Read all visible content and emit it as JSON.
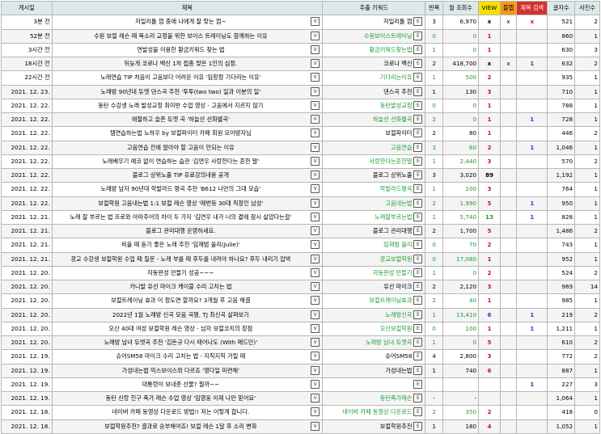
{
  "headers": {
    "date": "게시일",
    "title": "제목",
    "keyword": "추출 키워드",
    "count": "반복",
    "views": "월 조회수",
    "view_flag": "VIEW",
    "blog_flag": "블랩",
    "title_search": "제목 검색",
    "chars": "글자수",
    "photos": "사진수"
  },
  "button_labels": {
    "view": "V",
    "extract": "E"
  },
  "rows": [
    {
      "date": "3분 전",
      "title": "자일리톨 껌 중에 나에게 잘 맞는 껌~",
      "keyword": "자일리톨 껌",
      "kw_green": false,
      "count": "3",
      "count_green": false,
      "views": "6,970",
      "views_green": false,
      "view_flag": "x",
      "view_color": "black",
      "blog": "x",
      "search": "x",
      "search_color": "red",
      "chars": "521",
      "photos": "2"
    },
    {
      "date": "52분 전",
      "title": "수원 보컬 레슨 때 목소리 교정을 위한 보이스 트레이닝도 함께하는 이유",
      "keyword": "수원보이스트레이닝",
      "kw_green": true,
      "count": "0",
      "count_green": true,
      "views": "0",
      "views_green": true,
      "view_flag": "1",
      "view_color": "red",
      "blog": "",
      "search": "",
      "search_color": "",
      "chars": "860",
      "photos": "1"
    },
    {
      "date": "3시간 전",
      "title": "연발성을 이용한 황금키워드 찾는 법",
      "keyword": "황금키워드찾는법",
      "kw_green": true,
      "count": "1",
      "count_green": true,
      "views": "0",
      "views_green": true,
      "view_flag": "1",
      "view_color": "red",
      "blog": "",
      "search": "",
      "search_color": "",
      "chars": "630",
      "photos": "3"
    },
    {
      "date": "18시간 전",
      "title": "뒤늦게 코로나 백신 1차 접종 맞은 1인의 심정.",
      "keyword": "코로나 백신",
      "kw_green": false,
      "count": "2",
      "count_green": false,
      "views": "418,700",
      "views_green": false,
      "view_flag": "x",
      "view_color": "black",
      "blog": "x",
      "search": "1",
      "search_color": "blue",
      "chars": "632",
      "photos": "2"
    },
    {
      "date": "22시간 전",
      "title": "노래연습 TIP 처음이 고음보다 어려운 이유 '임창정 기다리는 이유'",
      "keyword": "기다리는이유",
      "kw_green": true,
      "count": "1",
      "count_green": true,
      "views": "500",
      "views_green": true,
      "view_flag": "2",
      "view_color": "red",
      "blog": "",
      "search": "",
      "search_color": "",
      "chars": "935",
      "photos": "1"
    },
    {
      "date": "2021. 12. 23.",
      "title": "노래방 90년대 듀엣 댄스곡 추천 '투투(two two) 일과 이분의 일'",
      "keyword": "댄스곡 추천",
      "kw_green": false,
      "count": "1",
      "count_green": false,
      "views": "130",
      "views_green": false,
      "view_flag": "3",
      "view_color": "red",
      "blog": "",
      "search": "",
      "search_color": "",
      "chars": "710",
      "photos": "1"
    },
    {
      "date": "2021. 12. 22.",
      "title": "동탄 수강생 노래 발성교정 취미반 수업 영상 - 고음에서 지르지 않기",
      "keyword": "동탄발성교정",
      "kw_green": true,
      "count": "0",
      "count_green": true,
      "views": "0",
      "views_green": true,
      "view_flag": "1",
      "view_color": "red",
      "blog": "",
      "search": "",
      "search_color": "",
      "chars": "788",
      "photos": "1"
    },
    {
      "date": "2021. 12. 22.",
      "title": "애절하고 슬픈 듀엣 곡 '하늘선 선화별곡'",
      "keyword": "하늘선 선화별곡",
      "kw_green": true,
      "count": "2",
      "count_green": true,
      "views": "0",
      "views_green": true,
      "view_flag": "1",
      "view_color": "red",
      "blog": "",
      "search": "1",
      "search_color": "blue",
      "chars": "728",
      "photos": "1"
    },
    {
      "date": "2021. 12. 22.",
      "title": "탬연습하는법 노하우 by 보컬파이터 카페 회원 모아방자님",
      "keyword": "보컬파이터",
      "kw_green": false,
      "count": "2",
      "count_green": false,
      "views": "80",
      "views_green": false,
      "view_flag": "1",
      "view_color": "red",
      "blog": "",
      "search": "",
      "search_color": "",
      "chars": "446",
      "photos": "2"
    },
    {
      "date": "2021. 12. 22.",
      "title": "고음연습 전에 알아야 할 고음이 안되는 이유",
      "keyword": "고음연습",
      "kw_green": true,
      "count": "3",
      "count_green": true,
      "views": "60",
      "views_green": true,
      "view_flag": "2",
      "view_color": "red",
      "blog": "",
      "search": "1",
      "search_color": "blue",
      "chars": "1,046",
      "photos": "1"
    },
    {
      "date": "2021. 12. 22.",
      "title": "노래배우기 예코 없이 연습하는 습관 '김연우 사랑한다는 흔한 말'",
      "keyword": "사랑한다는흔한말",
      "kw_green": true,
      "count": "1",
      "count_green": true,
      "views": "2,440",
      "views_green": true,
      "view_flag": "3",
      "view_color": "red",
      "blog": "",
      "search": "",
      "search_color": "",
      "chars": "570",
      "photos": "2"
    },
    {
      "date": "2021. 12. 22.",
      "title": "블로그 상위노출 TIP 유료강의내용 공개",
      "keyword": "블로그 상위노출",
      "kw_green": false,
      "count": "3",
      "count_green": false,
      "views": "3,020",
      "views_green": false,
      "view_flag": "89",
      "view_color": "black",
      "blog": "",
      "search": "",
      "search_color": "",
      "chars": "1,192",
      "photos": "1"
    },
    {
      "date": "2021. 12. 22.",
      "title": "노래방 남자 90년대 락발라드 명곡 추천 'B612 나만의 그대 모습'",
      "keyword": "락발라드명곡",
      "kw_green": true,
      "count": "1",
      "count_green": true,
      "views": "100",
      "views_green": true,
      "view_flag": "3",
      "view_color": "red",
      "blog": "",
      "search": "",
      "search_color": "",
      "chars": "764",
      "photos": "1"
    },
    {
      "date": "2021. 12. 22.",
      "title": "보컬학원 고음내는법 1:1 보컬 레슨 영상 '매번등 30대 직장인 남성'",
      "keyword": "고음내는법",
      "kw_green": true,
      "count": "2",
      "count_green": true,
      "views": "1,990",
      "views_green": true,
      "view_flag": "5",
      "view_color": "red",
      "blog": "",
      "search": "1",
      "search_color": "blue",
      "chars": "950",
      "photos": "1"
    },
    {
      "date": "2021. 12. 21.",
      "title": "노래 잘 부르는 법 프로와 아마추어의 차이 두 가지 '김연우 내가 너의 곁에 잠시 살았다는걸'",
      "keyword": "노래잘부르는법",
      "kw_green": true,
      "count": "1",
      "count_green": true,
      "views": "5,740",
      "views_green": true,
      "view_flag": "13",
      "view_color": "green",
      "blog": "",
      "search": "1",
      "search_color": "blue",
      "chars": "828",
      "photos": "1"
    },
    {
      "date": "2021. 12. 21.",
      "title": "블로그 관리대행 운영하세요.",
      "keyword": "블로그 관리대행",
      "kw_green": false,
      "count": "2",
      "count_green": false,
      "views": "1,700",
      "views_green": false,
      "view_flag": "5",
      "view_color": "red",
      "blog": "",
      "search": "",
      "search_color": "",
      "chars": "1,486",
      "photos": "2"
    },
    {
      "date": "2021. 12. 21.",
      "title": "비올 때 듣기 좋은 노래 추천 '임재범 올리(Julie)'",
      "keyword": "임재범 올리",
      "kw_green": true,
      "count": "0",
      "count_green": true,
      "views": "70",
      "views_green": true,
      "view_flag": "2",
      "view_color": "red",
      "blog": "",
      "search": "",
      "search_color": "",
      "chars": "743",
      "photos": "1"
    },
    {
      "date": "2021. 12. 21.",
      "title": "광교 수강생 보컬학원 수업 때 질문 - 노래 부를 때 후두를 내려야 하나요? 후두 내리기 압박",
      "keyword": "광교보컬학원",
      "kw_green": true,
      "count": "0",
      "count_green": true,
      "views": "17,080",
      "views_green": true,
      "view_flag": "1",
      "view_color": "red",
      "blog": "",
      "search": "",
      "search_color": "",
      "chars": "952",
      "photos": "1"
    },
    {
      "date": "2021. 12. 20.",
      "title": "자동완성 만들기 성공~~~",
      "keyword": "자동완성 만들기",
      "kw_green": true,
      "count": "1",
      "count_green": true,
      "views": "0",
      "views_green": true,
      "view_flag": "2",
      "view_color": "red",
      "blog": "",
      "search": "",
      "search_color": "",
      "chars": "524",
      "photos": "2"
    },
    {
      "date": "2021. 12. 20.",
      "title": "카니발 유선 마이크 케이블 수리 고치는 법",
      "keyword": "유선 마이크",
      "kw_green": false,
      "count": "2",
      "count_green": false,
      "views": "2,120",
      "views_green": false,
      "view_flag": "3",
      "view_color": "red",
      "blog": "",
      "search": "",
      "search_color": "",
      "chars": "969",
      "photos": "14"
    },
    {
      "date": "2021. 12. 20.",
      "title": "보컬트레이닝 효과 이 정도면 할까요? 3개월 후 고음 해결",
      "keyword": "보컬트레이닝효과",
      "kw_green": true,
      "count": "2",
      "count_green": true,
      "views": "40",
      "views_green": true,
      "view_flag": "1",
      "view_color": "red",
      "blog": "",
      "search": "",
      "search_color": "",
      "chars": "985",
      "photos": "1"
    },
    {
      "date": "2021. 12. 20.",
      "title": "2022년 1월 노래방 신곡 모음 곡명, TJ 최신곡 살펴보기",
      "keyword": "노래방신곡",
      "kw_green": true,
      "count": "1",
      "count_green": true,
      "views": "13,410",
      "views_green": true,
      "view_flag": "6",
      "view_color": "blue",
      "blog": "",
      "search": "1",
      "search_color": "blue",
      "chars": "219",
      "photos": "2"
    },
    {
      "date": "2021. 12. 20.",
      "title": "오산 40대 여성 보컬학원 레슨 영상 - 남자 보컬코치의 장점",
      "keyword": "오산보컬학원",
      "kw_green": true,
      "count": "0",
      "count_green": true,
      "views": "100",
      "views_green": true,
      "view_flag": "1",
      "view_color": "red",
      "blog": "",
      "search": "1",
      "search_color": "blue",
      "chars": "1,211",
      "photos": "1"
    },
    {
      "date": "2021. 12. 20.",
      "title": "노래방 남녀 듀엣곡 추천 '김돈규 다시 태어나도 (With 메드민)'",
      "keyword": "노래방 남녀 듀엣곡",
      "kw_green": true,
      "count": "1",
      "count_green": true,
      "views": "0",
      "views_green": true,
      "view_flag": "5",
      "view_color": "red",
      "blog": "",
      "search": "",
      "search_color": "",
      "chars": "610",
      "photos": "2"
    },
    {
      "date": "2021. 12. 19.",
      "title": "슈어SM58 마이크 수리 고치는 법 - 지직지직 거릴 때",
      "keyword": "슈어SM58",
      "kw_green": false,
      "count": "4",
      "count_green": false,
      "views": "2,800",
      "views_green": false,
      "view_flag": "3",
      "view_color": "red",
      "blog": "",
      "search": "",
      "search_color": "",
      "chars": "772",
      "photos": "2"
    },
    {
      "date": "2021. 12. 19.",
      "title": "가성내는법 믹스보이스와 다르죠 '영다일 미련해'",
      "keyword": "가성내는법",
      "kw_green": false,
      "count": "1",
      "count_green": false,
      "views": "740",
      "views_green": false,
      "view_flag": "6",
      "view_color": "red",
      "blog": "",
      "search": "",
      "search_color": "",
      "chars": "887",
      "photos": "1"
    },
    {
      "date": "2021. 12. 19.",
      "title": "대통령이 보내준 선물? 뭘까~~",
      "keyword": "",
      "kw_green": false,
      "count": "",
      "count_green": false,
      "views": "",
      "views_green": false,
      "view_flag": "",
      "view_color": "",
      "blog": "",
      "search": "1",
      "search_color": "blue",
      "chars": "227",
      "photos": "3"
    },
    {
      "date": "2021. 12. 19.",
      "title": "동탄 신랑 친구 축가 레슨 수업 영상 '임영웅 이제 나만 믿어요'",
      "keyword": "동탄축가레슨",
      "kw_green": true,
      "count": "-",
      "count_green": false,
      "views": "-",
      "views_green": false,
      "view_flag": "",
      "view_color": "",
      "blog": "",
      "search": "",
      "search_color": "",
      "chars": "1,064",
      "photos": "1"
    },
    {
      "date": "2021. 12. 18.",
      "title": "네이버 카페 동영상 다운로드 방법!! 저는 이렇게 합니다.",
      "keyword": "네이버 카페 동영상 다운로드",
      "kw_green": true,
      "count": "2",
      "count_green": true,
      "views": "350",
      "views_green": true,
      "view_flag": "2",
      "view_color": "red",
      "blog": "",
      "search": "",
      "search_color": "",
      "chars": "418",
      "photos": "0"
    },
    {
      "date": "2021. 12. 18.",
      "title": "보컬학원추천? 결과로 승부해야죠! 보컬 레슨 1달 후 소리 변화",
      "keyword": "보컬학원추천",
      "kw_green": false,
      "count": "1",
      "count_green": false,
      "views": "180",
      "views_green": false,
      "view_flag": "4",
      "view_color": "red",
      "blog": "",
      "search": "",
      "search_color": "",
      "chars": "1,052",
      "photos": "1"
    }
  ]
}
